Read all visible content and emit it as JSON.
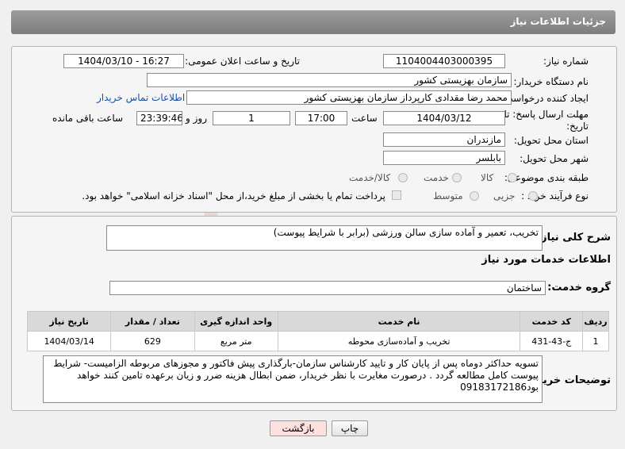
{
  "header": {
    "title": "جزئیات اطلاعات نیاز"
  },
  "form": {
    "need_number_label": "شماره نیاز:",
    "need_number": "1104004403000395",
    "announce_label": "تاریخ و ساعت اعلان عمومی:",
    "announce_value": "1404/03/10 - 16:27",
    "buyer_org_label": "نام دستگاه خریدار:",
    "buyer_org": "سازمان بهزیستی کشور",
    "requester_label": "ایجاد کننده درخواست:",
    "requester": "محمد رضا  مقدادی کارپرداز سازمان بهزیستی کشور",
    "buyer_contact_link": "اطلاعات تماس خریدار",
    "deadline_label_1": "مهلت ارسال پاسخ: تا",
    "deadline_label_2": "تاریخ:",
    "deadline_date": "1404/03/12",
    "time_label": "ساعت",
    "deadline_time": "17:00",
    "days_value": "1",
    "days_label": "روز و",
    "remaining_time": "23:39:46",
    "remaining_label": "ساعت باقی مانده",
    "province_label": "استان محل تحویل:",
    "province": "مازندران",
    "city_label": "شهر محل تحویل:",
    "city": "بابلسر",
    "category_label": "طبقه بندی موضوعی:",
    "category_options": [
      "کالا",
      "خدمت",
      "کالا/خدمت"
    ],
    "process_label": "نوع فرآیند خرید :",
    "process_options": [
      "جزیی",
      "متوسط"
    ],
    "payment_note": "پرداخت تمام یا بخشی از مبلغ خرید،از محل \"اسناد خزانه اسلامی\" خواهد بود."
  },
  "description": {
    "label": "شرح کلی نیاز:",
    "value": "تخریب، تعمیر و آماده سازی سالن ورزشی (برابر با شرایط پیوست)"
  },
  "services": {
    "section_title": "اطلاعات خدمات مورد نیاز",
    "group_label": "گروه خدمت:",
    "group_value": "ساختمان",
    "columns": [
      "ردیف",
      "کد خدمت",
      "نام خدمت",
      "واحد اندازه گیری",
      "تعداد / مقدار",
      "تاریخ نیاز"
    ],
    "rows": [
      [
        "1",
        "ج-43-431",
        "تخریب و آماده‌سازی محوطه",
        "متر مربع",
        "629",
        "1404/03/14"
      ]
    ]
  },
  "buyer_notes": {
    "label": "توضیحات خریدار:",
    "value": "تسویه حداکثر دوماه پس از پایان کار و تایید کارشناس سازمان-بارگذاری پیش فاکتور و مجوزهای مربوطه الزامیست- شرایط پیوست کامل مطالعه گردد . درصورت مغایرت با نظر خریدار، ضمن ابطال هزینه ضرر و زیان برعهده تامین کنند خواهد بود09183172186"
  },
  "buttons": {
    "print": "چاپ",
    "back": "بازگشت"
  },
  "watermark": {
    "text": "AriaTender.neT"
  }
}
